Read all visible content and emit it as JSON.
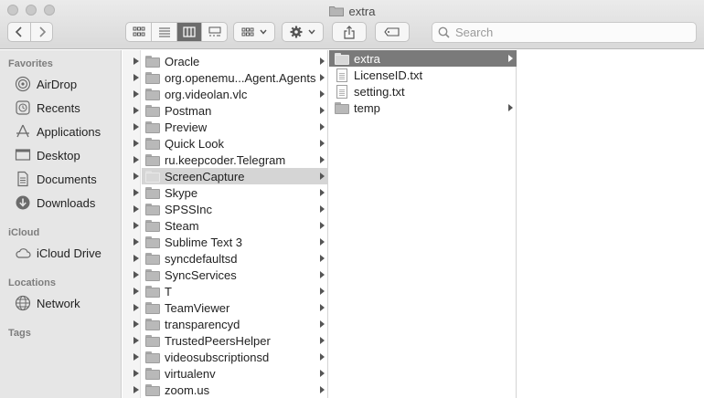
{
  "window": {
    "title": "extra",
    "colors": {
      "selected_row": "#7a7a7a",
      "parent_selected_row": "#d5d5d5",
      "sidebar_bg": "#e6e6e6"
    }
  },
  "toolbar": {
    "back_icon": "chevron-left-icon",
    "forward_icon": "chevron-right-icon",
    "view_modes": [
      "icon-view",
      "list-view",
      "column-view",
      "gallery-view"
    ],
    "active_view": "column-view",
    "search": {
      "placeholder": "Search",
      "value": ""
    }
  },
  "sidebar": {
    "sections": [
      {
        "header": "Favorites",
        "items": [
          {
            "label": "AirDrop",
            "icon": "airdrop-icon"
          },
          {
            "label": "Recents",
            "icon": "recents-icon"
          },
          {
            "label": "Applications",
            "icon": "applications-icon"
          },
          {
            "label": "Desktop",
            "icon": "desktop-icon"
          },
          {
            "label": "Documents",
            "icon": "documents-icon"
          },
          {
            "label": "Downloads",
            "icon": "downloads-icon"
          }
        ]
      },
      {
        "header": "iCloud",
        "items": [
          {
            "label": "iCloud Drive",
            "icon": "cloud-icon"
          }
        ]
      },
      {
        "header": "Locations",
        "items": [
          {
            "label": "Network",
            "icon": "network-icon"
          }
        ]
      },
      {
        "header": "Tags",
        "items": []
      }
    ]
  },
  "columns": {
    "col1": [
      {
        "name": "Oracle"
      },
      {
        "name": "org.openemu...Agent.Agents"
      },
      {
        "name": "org.videolan.vlc"
      },
      {
        "name": "Postman"
      },
      {
        "name": "Preview"
      },
      {
        "name": "Quick Look"
      },
      {
        "name": "ru.keepcoder.Telegram"
      },
      {
        "name": "ScreenCapture",
        "selected": true
      },
      {
        "name": "Skype"
      },
      {
        "name": "SPSSInc"
      },
      {
        "name": "Steam"
      },
      {
        "name": "Sublime Text 3"
      },
      {
        "name": "syncdefaultsd"
      },
      {
        "name": "SyncServices"
      },
      {
        "name": "T"
      },
      {
        "name": "TeamViewer"
      },
      {
        "name": "transparencyd"
      },
      {
        "name": "TrustedPeersHelper"
      },
      {
        "name": "videosubscriptionsd"
      },
      {
        "name": "virtualenv"
      },
      {
        "name": "zoom.us"
      }
    ],
    "col2": [
      {
        "name": "extra",
        "kind": "folder",
        "selected": true
      },
      {
        "name": "LicenseID.txt",
        "kind": "file"
      },
      {
        "name": "setting.txt",
        "kind": "file"
      },
      {
        "name": "temp",
        "kind": "folder"
      }
    ]
  }
}
